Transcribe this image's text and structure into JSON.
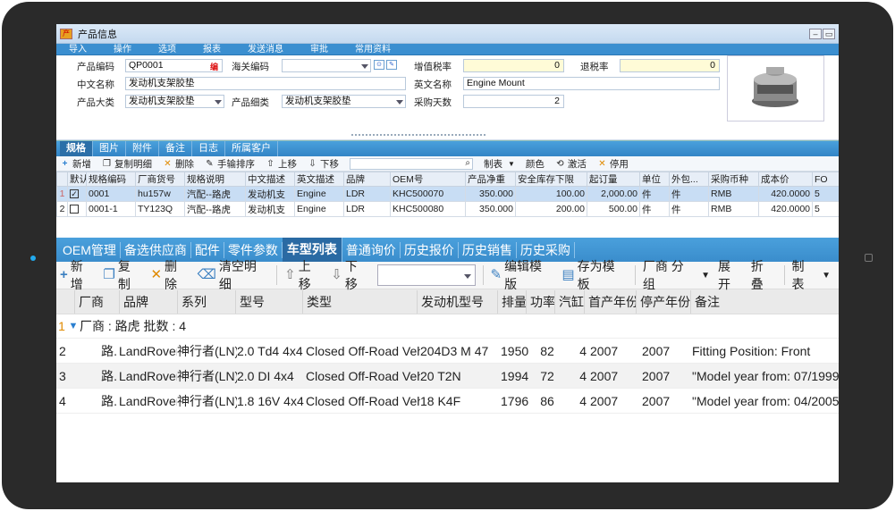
{
  "window": {
    "title": "产品信息",
    "icon_text": "产"
  },
  "menu": [
    "导入",
    "操作",
    "选项",
    "报表",
    "发送消息",
    "审批",
    "常用资料"
  ],
  "form": {
    "code_label": "产品编码",
    "code_value": "QP0001",
    "code_tag": "编",
    "hs_label": "海关编码",
    "hs_value": "",
    "vat_label": "增值税率",
    "vat_value": "0",
    "refund_label": "退税率",
    "refund_value": "0",
    "cn_label": "中文名称",
    "cn_value": "发动机支架胶垫",
    "en_label": "英文名称",
    "en_value": "Engine Mount",
    "cat_label": "产品大类",
    "cat_value": "发动机支架胶垫",
    "sub_label": "产品细类",
    "sub_value": "发动机支架胶垫",
    "days_label": "采购天数",
    "days_value": "2"
  },
  "tabs1": [
    "规格",
    "图片",
    "附件",
    "备注",
    "日志",
    "所属客户"
  ],
  "toolbar1": {
    "add": "新增",
    "copy": "复制明细",
    "del": "删除",
    "sort": "手输排序",
    "up": "上移",
    "down": "下移",
    "report": "制表",
    "color": "颜色",
    "activate": "激活",
    "disable": "停用"
  },
  "grid1": {
    "headers": [
      "",
      "默认",
      "规格编码",
      "厂商货号",
      "规格说明",
      "中文描述",
      "英文描述",
      "品牌",
      "OEM号",
      "产品净重",
      "安全库存下限",
      "起订量",
      "单位",
      "外包...",
      "采购币种",
      "成本价",
      "FO"
    ],
    "rows": [
      {
        "n": "1",
        "chk": "✓",
        "code": "0001",
        "vendor": "hu157w",
        "spec": "汽配--路虎",
        "cn": "发动机支",
        "en": "Engine",
        "brand": "LDR",
        "oem": "KHC500070",
        "weight": "350.000",
        "safe": "100.00",
        "moq": "2,000.00",
        "unit": "件",
        "pack": "件",
        "cur": "RMB",
        "cost": "420.0000",
        "fo": "5"
      },
      {
        "n": "2",
        "chk": "",
        "code": "0001-1",
        "vendor": "TY123Q",
        "spec": "汽配--路虎",
        "cn": "发动机支",
        "en": "Engine",
        "brand": "LDR",
        "oem": "KHC500080",
        "weight": "350.000",
        "safe": "200.00",
        "moq": "500.00",
        "unit": "件",
        "pack": "件",
        "cur": "RMB",
        "cost": "420.0000",
        "fo": "5"
      }
    ]
  },
  "tabs2": [
    "OEM管理",
    "备选供应商",
    "配件",
    "零件参数",
    "车型列表",
    "普通询价",
    "历史报价",
    "历史销售",
    "历史采购"
  ],
  "toolbar2": {
    "add": "新增",
    "copy": "复制",
    "del": "删除",
    "clear": "清空明细",
    "up": "上移",
    "down": "下移",
    "edit_tpl": "编辑模版",
    "save_tpl": "存为模板",
    "group": "厂商 分组",
    "expand": "展开",
    "fold": "折叠",
    "report": "制表"
  },
  "grid2": {
    "headers": [
      "",
      "厂商",
      "品牌",
      "系列",
      "型号",
      "类型",
      "发动机型号",
      "排量",
      "功率",
      "汽缸",
      "首产年份",
      "停产年份",
      "备注"
    ],
    "group": {
      "n": "1",
      "text": "厂商 : 路虎  批数 : 4"
    },
    "rows": [
      {
        "n": "2",
        "maker": "路.",
        "brand": "LandRover",
        "series": "神行者(LN)",
        "model": "2.0 Td4 4x4",
        "type": "Closed Off-Road Veh",
        "engine": "204D3  M 47",
        "disp": "1950",
        "power": "82",
        "cyl": "4",
        "start": "2007",
        "end": "2007",
        "note": "Fitting Position: Front"
      },
      {
        "n": "3",
        "maker": "路.",
        "brand": "LandRover",
        "series": "神行者(LN)",
        "model": "2.0 DI 4x4",
        "type": "Closed Off-Road Veh",
        "engine": "20 T2N",
        "disp": "1994",
        "power": "72",
        "cyl": "4",
        "start": "2007",
        "end": "2007",
        "note": "\"Model year from: 07/1999"
      },
      {
        "n": "4",
        "maker": "路.",
        "brand": "LandRover",
        "series": "神行者(LN)",
        "model": "1.8 16V 4x4",
        "type": "Closed Off-Road Veh",
        "engine": "18 K4F",
        "disp": "1796",
        "power": "86",
        "cyl": "4",
        "start": "2007",
        "end": "2007",
        "note": "\"Model year from: 04/2005"
      }
    ]
  }
}
